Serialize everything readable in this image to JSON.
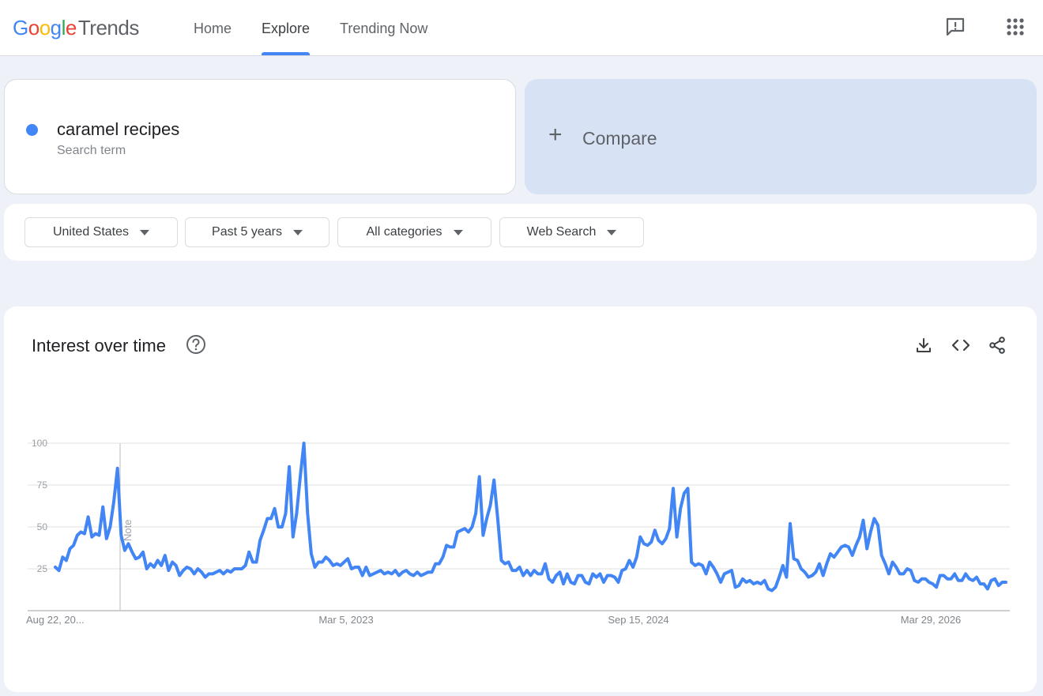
{
  "app": {
    "logo_google": [
      "G",
      "o",
      "o",
      "g",
      "l",
      "e"
    ],
    "logo_trends": "Trends"
  },
  "nav": {
    "items": [
      {
        "label": "Home"
      },
      {
        "label": "Explore",
        "active": true
      },
      {
        "label": "Trending Now"
      }
    ]
  },
  "header_icons": [
    "feedback-icon",
    "apps-grid-icon"
  ],
  "search": {
    "term": "caramel recipes",
    "term_type": "Search term",
    "term_color": "#4285f4",
    "compare_label": "Compare"
  },
  "filters": [
    {
      "label": "United States"
    },
    {
      "label": "Past 5 years"
    },
    {
      "label": "All categories"
    },
    {
      "label": "Web Search"
    }
  ],
  "interest": {
    "title": "Interest over time",
    "note_label": "Note",
    "tools": [
      "download-icon",
      "embed-code-icon",
      "share-icon"
    ]
  },
  "colors": {
    "accent": "#4285f4",
    "compare_bg": "#d7e3f5",
    "page_bg": "#eef1f8"
  },
  "chart_data": {
    "type": "line",
    "series": [
      {
        "name": "caramel recipes",
        "color": "#4285f4",
        "values": [
          26,
          24,
          32,
          30,
          37,
          39,
          45,
          47,
          46,
          56,
          44,
          46,
          45,
          62,
          43,
          50,
          65,
          85,
          45,
          36,
          40,
          35,
          31,
          32,
          35,
          25,
          28,
          26,
          30,
          27,
          33,
          24,
          29,
          27,
          21,
          24,
          26,
          25,
          22,
          25,
          23,
          20,
          22,
          22,
          23,
          24,
          22,
          24,
          23,
          25,
          25,
          25,
          27,
          35,
          29,
          29,
          42,
          48,
          55,
          55,
          61,
          50,
          50,
          58,
          86,
          44,
          58,
          80,
          100,
          58,
          34,
          26,
          29,
          29,
          32,
          30,
          27,
          28,
          27,
          29,
          31,
          25,
          26,
          26,
          21,
          26,
          21,
          22,
          23,
          24,
          22,
          23,
          22,
          24,
          21,
          23,
          24,
          22,
          21,
          23,
          21,
          22,
          23,
          23,
          28,
          28,
          32,
          39,
          38,
          38,
          47,
          48,
          49,
          47,
          50,
          58,
          80,
          45,
          55,
          63,
          78,
          55,
          30,
          28,
          29,
          24,
          24,
          26,
          21,
          24,
          21,
          24,
          22,
          22,
          28,
          19,
          17,
          21,
          23,
          16,
          22,
          17,
          16,
          21,
          21,
          17,
          16,
          22,
          20,
          22,
          17,
          21,
          21,
          20,
          17,
          24,
          25,
          30,
          26,
          32,
          44,
          40,
          39,
          41,
          48,
          42,
          40,
          43,
          49,
          73,
          44,
          61,
          70,
          73,
          29,
          27,
          28,
          27,
          22,
          29,
          26,
          22,
          17,
          22,
          23,
          24,
          14,
          15,
          19,
          17,
          18,
          16,
          17,
          16,
          18,
          13,
          12,
          14,
          20,
          27,
          20,
          52,
          31,
          30,
          25,
          23,
          20,
          21,
          23,
          28,
          21,
          28,
          34,
          32,
          35,
          38,
          39,
          38,
          33,
          39,
          44,
          54,
          37,
          47,
          55,
          51,
          33,
          28,
          22,
          29,
          26,
          22,
          22,
          25,
          24,
          18,
          17,
          19,
          19,
          17,
          16,
          14,
          21,
          21,
          19,
          19,
          22,
          18,
          18,
          22,
          19,
          18,
          20,
          16,
          16,
          13,
          18,
          19,
          15,
          17,
          17
        ]
      }
    ],
    "x_tick_labels": [
      "Aug 22, 20...",
      "Mar 5, 2023",
      "Sep 15, 2024",
      "Mar 29, 2026"
    ],
    "y_ticks": [
      25,
      50,
      75,
      100
    ],
    "ylim": [
      0,
      100
    ],
    "grid": true,
    "legend": "none"
  }
}
